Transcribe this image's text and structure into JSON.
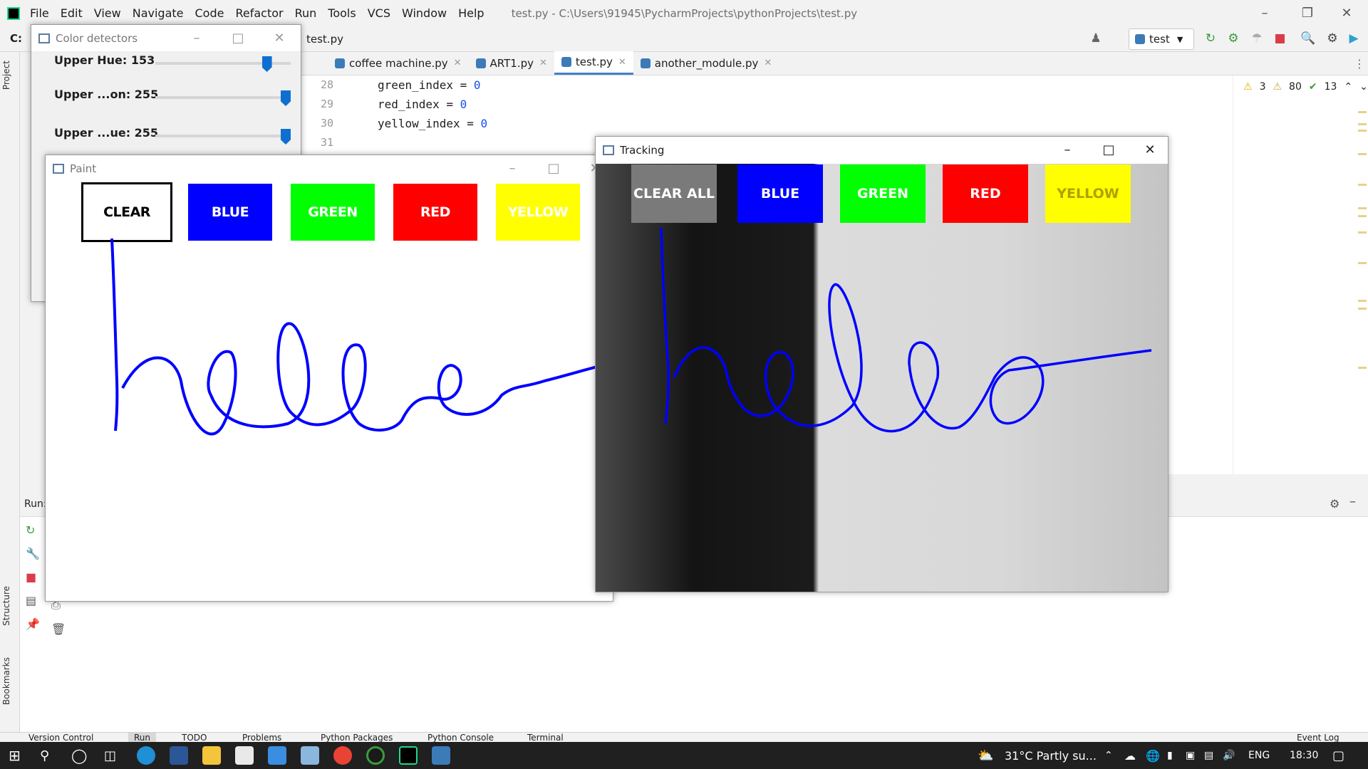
{
  "ide": {
    "menu": [
      "File",
      "Edit",
      "View",
      "Navigate",
      "Code",
      "Refactor",
      "Run",
      "Tools",
      "VCS",
      "Window",
      "Help"
    ],
    "title": "test.py - C:\\Users\\91945\\PycharmProjects\\pythonProjects\\test.py",
    "breadcrumb_drive": "C:",
    "breadcrumb_file": "test.py",
    "run_config": "test",
    "tabs": [
      {
        "label": "coffee machine.py",
        "active": false
      },
      {
        "label": "ART1.py",
        "active": false
      },
      {
        "label": "test.py",
        "active": true
      },
      {
        "label": "another_module.py",
        "active": false
      }
    ],
    "code_lines": [
      {
        "num": "28",
        "var": "green_index = ",
        "val": "0"
      },
      {
        "num": "29",
        "var": "red_index = ",
        "val": "0"
      },
      {
        "num": "30",
        "var": "yellow_index = ",
        "val": "0"
      },
      {
        "num": "31",
        "var": "",
        "val": ""
      }
    ],
    "inspections": {
      "warnings_a": "3",
      "warnings_b": "80",
      "ok": "13"
    },
    "run_label": "Run:",
    "side_tabs": [
      "Project",
      "Structure",
      "Bookmarks"
    ],
    "status_tabs": [
      "Version Control",
      "Run",
      "TODO",
      "Problems",
      "Python Packages",
      "Python Console",
      "Terminal"
    ],
    "event_log": "Event Log"
  },
  "color_detectors": {
    "title": "Color detectors",
    "sliders": [
      {
        "label": "Upper Hue: 153",
        "fraction": 0.85
      },
      {
        "label": "Upper ...on: 255",
        "fraction": 1.0
      },
      {
        "label": "Upper ...ue: 255",
        "fraction": 1.0
      }
    ]
  },
  "paint": {
    "title": "Paint",
    "buttons": [
      {
        "label": "CLEAR",
        "color": "#ffffff",
        "text_color": "#000000"
      },
      {
        "label": "BLUE",
        "color": "#0000ff",
        "text_color": "#ffffff"
      },
      {
        "label": "GREEN",
        "color": "#00ff00",
        "text_color": "#ffffff"
      },
      {
        "label": "RED",
        "color": "#ff0000",
        "text_color": "#ffffff"
      },
      {
        "label": "YELLOW",
        "color": "#ffff00",
        "text_color": "#ffffff"
      }
    ],
    "stroke_color": "#0000ff"
  },
  "tracking": {
    "title": "Tracking",
    "buttons": [
      {
        "label": "CLEAR ALL",
        "color": "#7a7a7a"
      },
      {
        "label": "BLUE",
        "color": "#0000ff"
      },
      {
        "label": "GREEN",
        "color": "#00ff00"
      },
      {
        "label": "RED",
        "color": "#ff0000"
      },
      {
        "label": "YELLOW",
        "color": "#ffff00"
      }
    ]
  },
  "taskbar": {
    "weather": "31°C  Partly su...",
    "lang": "ENG",
    "time": "18:30"
  }
}
